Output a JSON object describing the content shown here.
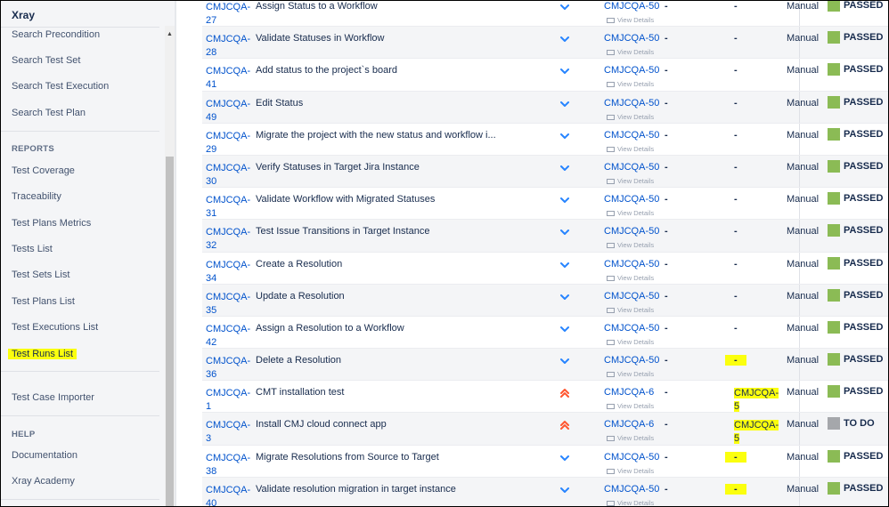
{
  "sidebar": {
    "title": "Xray",
    "items_top": [
      "Search Precondition",
      "Search Test Set",
      "Search Test Execution",
      "Search Test Plan"
    ],
    "reports_heading": "REPORTS",
    "reports": [
      "Test Coverage",
      "Traceability",
      "Test Plans Metrics",
      "Tests List",
      "Test Sets List",
      "Test Plans List",
      "Test Executions List",
      "Test Runs List"
    ],
    "importer": "Test Case Importer",
    "help_heading": "HELP",
    "help": [
      "Documentation",
      "Xray Academy"
    ]
  },
  "table": {
    "view_details_label": "View Details",
    "rows": [
      {
        "key": "CMJCQA-27",
        "key_l1": "CMJCQA-",
        "key_l2": "27",
        "summary": "Assign Status to a Workflow",
        "priority": "low",
        "execution": "CMJCQA-50",
        "col1": "-",
        "defects": "-",
        "defects_l2": "",
        "exec_type": "Manual",
        "status": "PASSED"
      },
      {
        "key": "CMJCQA-28",
        "key_l1": "CMJCQA-",
        "key_l2": "28",
        "summary": "Validate Statuses in Workflow",
        "priority": "low",
        "execution": "CMJCQA-50",
        "col1": "-",
        "defects": "-",
        "defects_l2": "",
        "exec_type": "Manual",
        "status": "PASSED"
      },
      {
        "key": "CMJCQA-41",
        "key_l1": "CMJCQA-",
        "key_l2": "41",
        "summary": "Add status to the project`s board",
        "priority": "low",
        "execution": "CMJCQA-50",
        "col1": "-",
        "defects": "-",
        "defects_l2": "",
        "exec_type": "Manual",
        "status": "PASSED"
      },
      {
        "key": "CMJCQA-49",
        "key_l1": "CMJCQA-",
        "key_l2": "49",
        "summary": "Edit Status",
        "priority": "low",
        "execution": "CMJCQA-50",
        "col1": "-",
        "defects": "-",
        "defects_l2": "",
        "exec_type": "Manual",
        "status": "PASSED"
      },
      {
        "key": "CMJCQA-29",
        "key_l1": "CMJCQA-",
        "key_l2": "29",
        "summary": "Migrate the project with the new status and workflow i...",
        "priority": "low",
        "execution": "CMJCQA-50",
        "col1": "-",
        "defects": "-",
        "defects_l2": "",
        "exec_type": "Manual",
        "status": "PASSED"
      },
      {
        "key": "CMJCQA-30",
        "key_l1": "CMJCQA-",
        "key_l2": "30",
        "summary": "Verify Statuses in Target Jira Instance",
        "priority": "low",
        "execution": "CMJCQA-50",
        "col1": "-",
        "defects": "-",
        "defects_l2": "",
        "exec_type": "Manual",
        "status": "PASSED"
      },
      {
        "key": "CMJCQA-31",
        "key_l1": "CMJCQA-",
        "key_l2": "31",
        "summary": "Validate Workflow with Migrated Statuses",
        "priority": "low",
        "execution": "CMJCQA-50",
        "col1": "-",
        "defects": "-",
        "defects_l2": "",
        "exec_type": "Manual",
        "status": "PASSED"
      },
      {
        "key": "CMJCQA-32",
        "key_l1": "CMJCQA-",
        "key_l2": "32",
        "summary": "Test Issue Transitions in Target Instance",
        "priority": "low",
        "execution": "CMJCQA-50",
        "col1": "-",
        "defects": "-",
        "defects_l2": "",
        "exec_type": "Manual",
        "status": "PASSED"
      },
      {
        "key": "CMJCQA-34",
        "key_l1": "CMJCQA-",
        "key_l2": "34",
        "summary": "Create a Resolution",
        "priority": "low",
        "execution": "CMJCQA-50",
        "col1": "-",
        "defects": "-",
        "defects_l2": "",
        "exec_type": "Manual",
        "status": "PASSED"
      },
      {
        "key": "CMJCQA-35",
        "key_l1": "CMJCQA-",
        "key_l2": "35",
        "summary": "Update a Resolution",
        "priority": "low",
        "execution": "CMJCQA-50",
        "col1": "-",
        "defects": "-",
        "defects_l2": "",
        "exec_type": "Manual",
        "status": "PASSED"
      },
      {
        "key": "CMJCQA-42",
        "key_l1": "CMJCQA-",
        "key_l2": "42",
        "summary": "Assign a Resolution to a Workflow",
        "priority": "low",
        "execution": "CMJCQA-50",
        "col1": "-",
        "defects": "-",
        "defects_l2": "",
        "exec_type": "Manual",
        "status": "PASSED"
      },
      {
        "key": "CMJCQA-36",
        "key_l1": "CMJCQA-",
        "key_l2": "36",
        "summary": "Delete a Resolution",
        "priority": "low",
        "execution": "CMJCQA-50",
        "col1": "-",
        "defects": "-",
        "defects_l2": "",
        "highlight": true,
        "exec_type": "Manual",
        "status": "PASSED"
      },
      {
        "key": "CMJCQA-1",
        "key_l1": "CMJCQA-",
        "key_l2": "1",
        "summary": "CMT installation test",
        "priority": "highest",
        "execution": "CMJCQA-6",
        "col1": "-",
        "defects": "CMJCQA-",
        "defects_l2": "5",
        "highlight": true,
        "exec_type": "Manual",
        "status": "PASSED"
      },
      {
        "key": "CMJCQA-3",
        "key_l1": "CMJCQA-",
        "key_l2": "3",
        "summary": "Install CMJ cloud connect app",
        "priority": "highest",
        "execution": "CMJCQA-6",
        "col1": "-",
        "defects": "CMJCQA-",
        "defects_l2": "5",
        "highlight": true,
        "exec_type": "Manual",
        "status": "TO DO"
      },
      {
        "key": "CMJCQA-38",
        "key_l1": "CMJCQA-",
        "key_l2": "38",
        "summary": "Migrate Resolutions from Source to Target",
        "priority": "low",
        "execution": "CMJCQA-50",
        "col1": "-",
        "defects": "-",
        "defects_l2": "",
        "highlight": true,
        "exec_type": "Manual",
        "status": "PASSED"
      },
      {
        "key": "CMJCQA-40",
        "key_l1": "CMJCQA-",
        "key_l2": "40",
        "summary": "Validate resolution migration in target instance",
        "priority": "low",
        "execution": "CMJCQA-50",
        "col1": "-",
        "defects": "-",
        "defects_l2": "",
        "highlight": true,
        "exec_type": "Manual",
        "status": "PASSED"
      }
    ]
  },
  "colors": {
    "passed": "#8bbb55",
    "todo": "#a5a7ab",
    "link": "#0052cc",
    "highlight": "#fbff0e",
    "priority_low": "#2684ff",
    "priority_highest": "#ff5630"
  }
}
